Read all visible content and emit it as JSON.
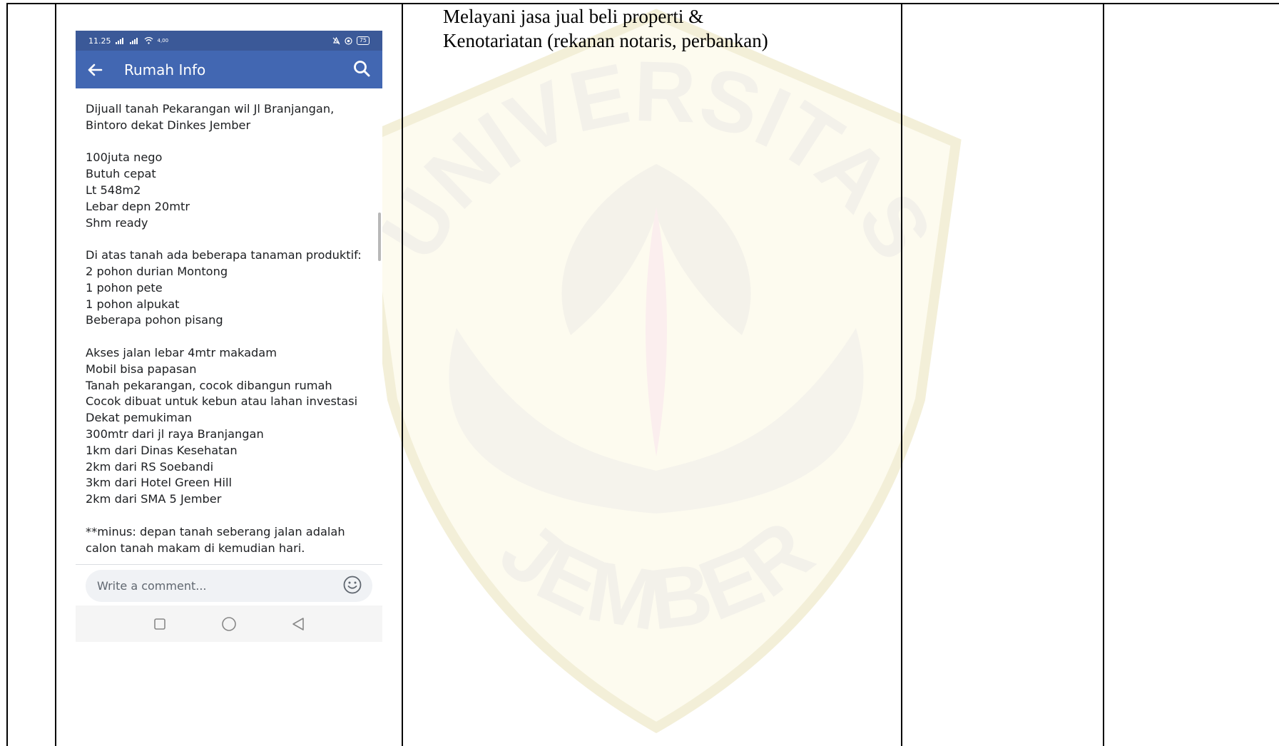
{
  "document": {
    "description_lines": [
      "Melayani jasa jual beli properti &",
      "Kenotariatan (rekanan notaris, perbankan)"
    ]
  },
  "phone": {
    "status": {
      "time": "11.25",
      "data_speed": "4,00",
      "battery": "75"
    },
    "app_title": "Rumah Info",
    "post_lines": [
      "Dijuall tanah Pekarangan wil Jl Branjangan,",
      "Bintoro dekat Dinkes Jember",
      "",
      "100juta nego",
      "Butuh cepat",
      "Lt 548m2",
      "Lebar depn 20mtr",
      "Shm ready",
      "",
      "Di atas tanah ada beberapa tanaman produktif:",
      "2 pohon durian Montong",
      "1 pohon pete",
      "1 pohon alpukat",
      "Beberapa pohon pisang",
      "",
      "Akses jalan lebar 4mtr makadam",
      "Mobil bisa papasan",
      "Tanah pekarangan, cocok dibangun rumah",
      "Cocok dibuat untuk kebun atau lahan investasi",
      "Dekat pemukiman",
      "300mtr dari jl raya Branjangan",
      "1km dari Dinas Kesehatan",
      "2km dari RS Soebandi",
      "3km dari Hotel Green Hill",
      "2km dari SMA 5 Jember",
      "",
      "**minus: depan tanah seberang jalan adalah",
      "calon tanah makam di kemudian hari."
    ],
    "comment_placeholder": "Write a comment...",
    "colors": {
      "statusbar": "#3b5998",
      "appbar": "#4267b2"
    },
    "icons": [
      "back-arrow-icon",
      "search-icon",
      "emoji-icon",
      "recent-apps-icon",
      "home-icon",
      "back-nav-icon"
    ]
  },
  "watermark": {
    "text_top": "UNIVERSITAS",
    "text_bottom": "JEMBER"
  }
}
